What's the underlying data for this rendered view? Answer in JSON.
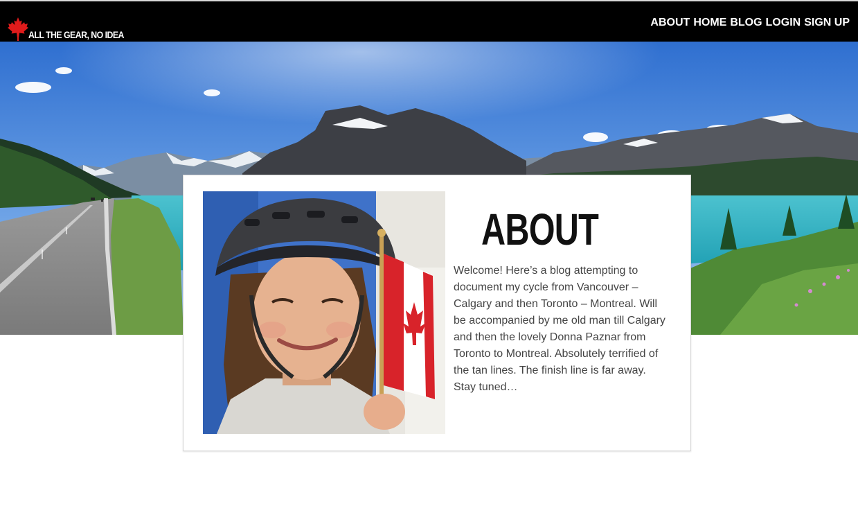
{
  "header": {
    "logo_text": "ALL THE GEAR, NO IDEA",
    "nav": [
      "ABOUT",
      "HOME",
      "BLOG",
      "LOGIN",
      "SIGN UP"
    ]
  },
  "about": {
    "title": "ABOUT",
    "body": "Welcome! Here’s a blog attempting to document my cycle from Vancouver – Calgary and then Toronto – Montreal. Will be accompanied by me old man till Calgary and then the lovely Donna Paznar from Toronto to Montreal. Absolutely terrified of the tan lines. The finish line is far away. Stay tuned…"
  },
  "colors": {
    "nav_background": "#000000",
    "maple_red": "#e01b1b",
    "lake_turquoise": "#2fb4c4",
    "sky_blue": "#4a86d8"
  }
}
